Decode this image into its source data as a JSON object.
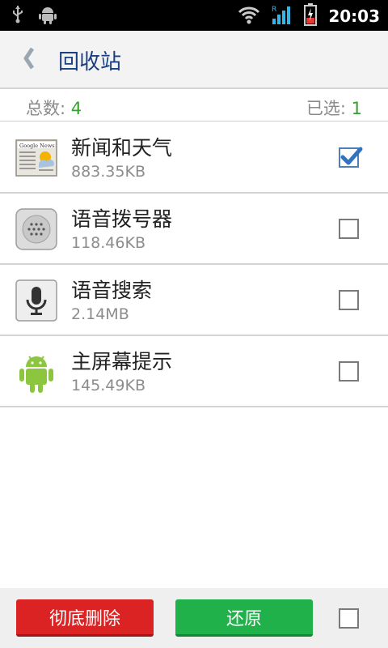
{
  "status_bar": {
    "time": "20:03",
    "icons": [
      "usb-icon",
      "android-debug-icon",
      "wifi-icon",
      "signal-icon",
      "battery-charging-icon"
    ]
  },
  "header": {
    "back_icon": "chevron-left-icon",
    "title": "回收站"
  },
  "summary": {
    "total_label": "总数:",
    "total_value": "4",
    "selected_label": "已选:",
    "selected_value": "1"
  },
  "items": [
    {
      "name": "新闻和天气",
      "size": "883.35KB",
      "icon": "news-weather-icon",
      "checked": true
    },
    {
      "name": "语音拨号器",
      "size": "118.46KB",
      "icon": "voice-dialer-icon",
      "checked": false
    },
    {
      "name": "语音搜索",
      "size": "2.14MB",
      "icon": "voice-search-icon",
      "checked": false
    },
    {
      "name": "主屏幕提示",
      "size": "145.49KB",
      "icon": "android-icon",
      "checked": false
    }
  ],
  "bottom": {
    "delete_label": "彻底删除",
    "restore_label": "还原",
    "select_all_checked": false
  },
  "colors": {
    "title": "#1c3f80",
    "count_green": "#35a12e",
    "delete_red": "#dc2323",
    "restore_green": "#21b14b"
  }
}
